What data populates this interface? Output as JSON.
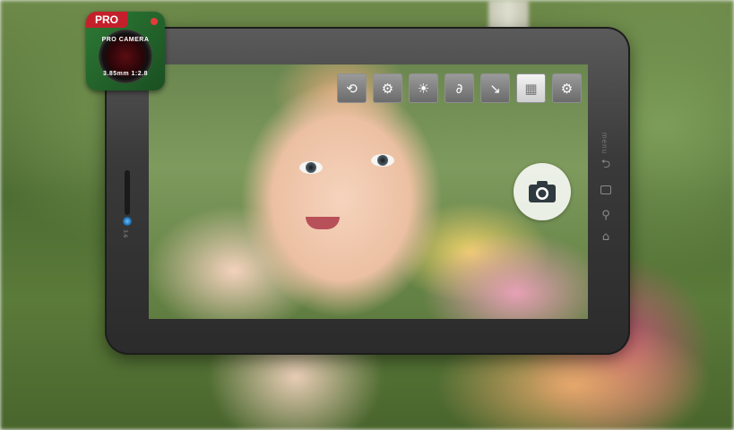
{
  "logo": {
    "ribbon_text": "PRO",
    "lens_text_top": "PRO CAMERA",
    "lens_text_bottom": "3.85mm 1:2.8"
  },
  "tablet": {
    "menu_label": "menu",
    "side_text": "3.6"
  },
  "toolbar": {
    "items": [
      {
        "icon": "camera-switch-icon"
      },
      {
        "icon": "settings-camera-icon"
      },
      {
        "icon": "brightness-icon"
      },
      {
        "icon": "effect-icon"
      },
      {
        "icon": "flash-icon"
      },
      {
        "icon": "gallery-icon"
      },
      {
        "icon": "gear-icon"
      }
    ]
  },
  "shutter": {
    "icon": "camera-icon"
  }
}
